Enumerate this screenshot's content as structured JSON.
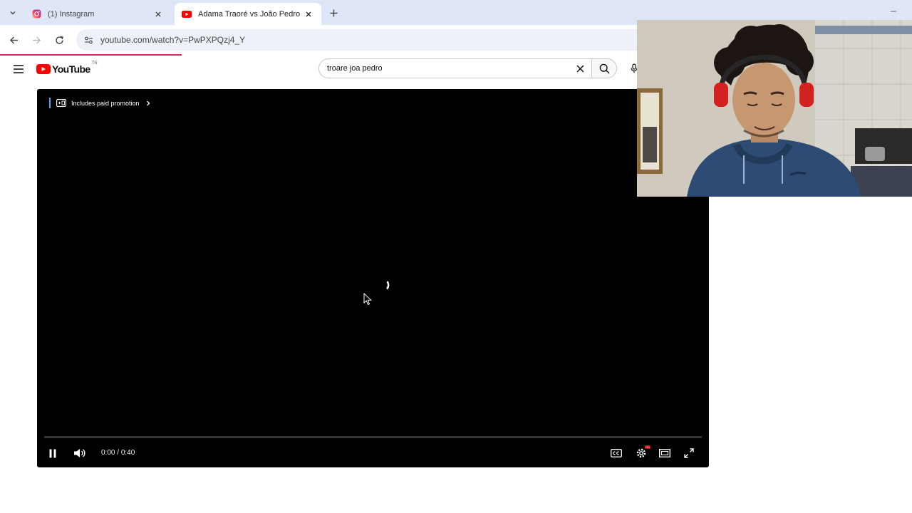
{
  "browser": {
    "tabs": [
      {
        "title": "(1) Instagram",
        "icon": "instagram-icon",
        "active": false
      },
      {
        "title": "Adama Traoré vs João Pedro HD",
        "icon": "youtube-icon",
        "active": true
      }
    ],
    "url": "youtube.com/watch?v=PwPXPQzj4_Y",
    "accent_color": "#e0245e"
  },
  "youtube": {
    "logo_text": "YouTube",
    "country_code": "TN",
    "search": {
      "query": "troare joa pedro"
    }
  },
  "player": {
    "promo_label": "Includes paid promotion",
    "current_time": "0:00",
    "separator": " / ",
    "duration": "0:40",
    "progress_fraction": 0,
    "state": "buffering",
    "quality_badge": "HD",
    "icons": [
      "pause-icon",
      "volume-icon",
      "captions-icon",
      "settings-icon",
      "theater-mode-icon",
      "fullscreen-icon"
    ]
  },
  "webcam": {
    "subject": "person in blue hoodie with red headphones"
  }
}
